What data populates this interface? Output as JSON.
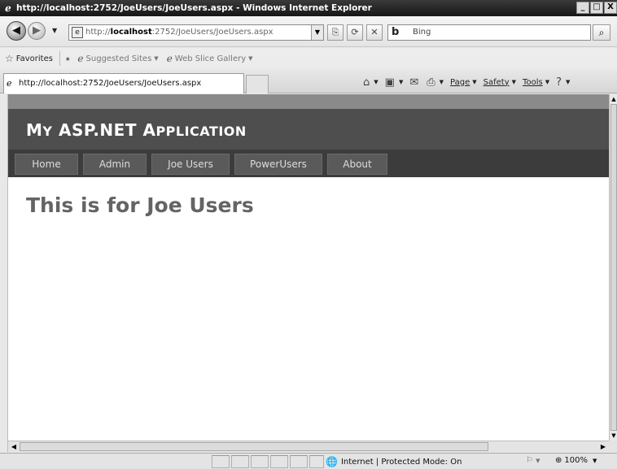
{
  "window": {
    "title": "http://localhost:2752/JoeUsers/JoeUsers.aspx - Windows Internet Explorer",
    "minimize_label": "_",
    "restore_label": "□",
    "close_label": "X"
  },
  "address_bar": {
    "url_prefix": "http://",
    "url_host": "localhost",
    "url_rest": ":2752/JoeUsers/JoeUsers.aspx"
  },
  "search": {
    "provider": "Bing",
    "placeholder": "Bing"
  },
  "favorites_bar": {
    "favorites_label": "Favorites",
    "items": [
      {
        "label": "Suggested Sites",
        "icon": "ie-icon"
      },
      {
        "label": "Web Slice Gallery",
        "icon": "ie-page-icon"
      }
    ]
  },
  "tabs": [
    {
      "label": "http://localhost:2752/JoeUsers/JoeUsers.aspx"
    }
  ],
  "command_bar": {
    "page_label": "Page",
    "safety_label": "Safety",
    "tools_label": "Tools",
    "help_label": "?"
  },
  "page": {
    "app_title": "My ASP.NET Application",
    "app_title_parts": [
      {
        "big": "M",
        "small": "Y"
      },
      {
        "big": "ASP.NET",
        "small": ""
      },
      {
        "big": "A",
        "small": "PPLICATION"
      }
    ],
    "menu": [
      {
        "label": "Home"
      },
      {
        "label": "Admin"
      },
      {
        "label": "Joe Users"
      },
      {
        "label": "PowerUsers"
      },
      {
        "label": "About"
      }
    ],
    "heading": "This is for Joe Users"
  },
  "status_bar": {
    "zone": "Internet | Protected Mode: On",
    "zoom": "100%"
  },
  "colors": {
    "header_bg": "#4e4e4e",
    "menu_bg": "#3c3c3c",
    "menu_item_bg": "#5a5a5a",
    "heading_color": "#646464"
  }
}
